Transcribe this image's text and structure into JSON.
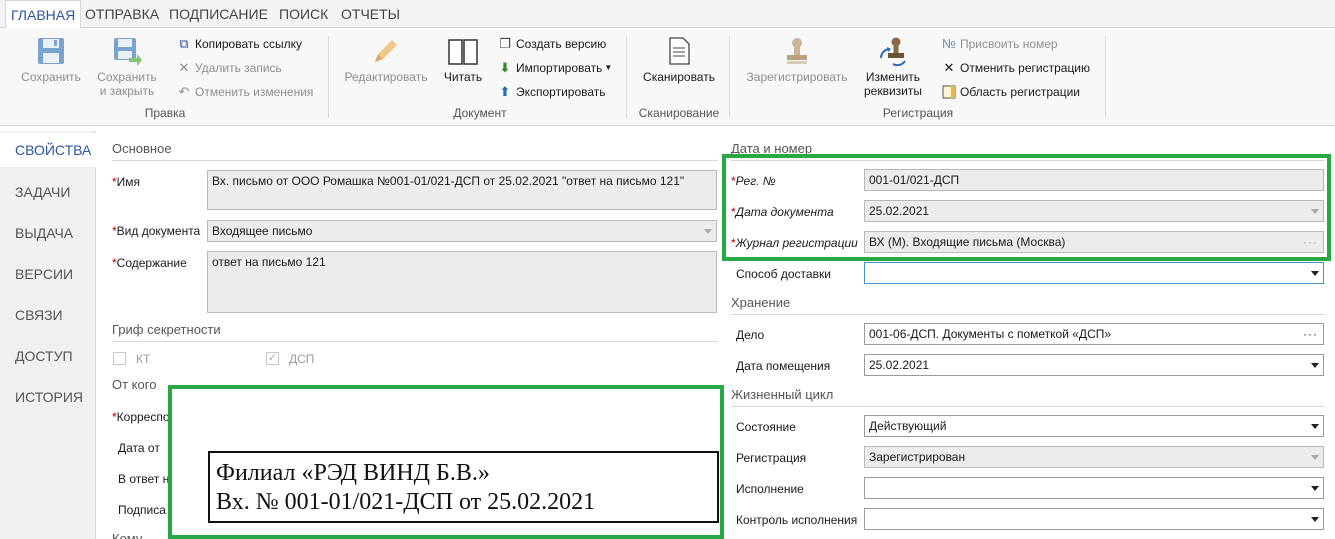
{
  "menu": {
    "tabs": [
      "ГЛАВНАЯ",
      "ОТПРАВКА",
      "ПОДПИСАНИЕ",
      "ПОИСК",
      "ОТЧЕТЫ"
    ]
  },
  "ribbon": {
    "save": "Сохранить",
    "save_close_1": "Сохранить",
    "save_close_2": "и закрыть",
    "copy_link": "Копировать ссылку",
    "delete_record": "Удалить запись",
    "undo_changes": "Отменить изменения",
    "group_edit": "Правка",
    "edit": "Редактировать",
    "read": "Читать",
    "create_version": "Создать версию",
    "import": "Импортировать",
    "export": "Экспортировать",
    "group_document": "Документ",
    "scan": "Сканировать",
    "group_scanning": "Сканирование",
    "register": "Зарегистрировать",
    "change_req_1": "Изменить",
    "change_req_2": "реквизиты",
    "assign_number": "Присвоить номер",
    "cancel_registration": "Отменить регистрацию",
    "registration_area": "Область регистрации",
    "group_registration": "Регистрация"
  },
  "nav": [
    "СВОЙСТВА",
    "ЗАДАЧИ",
    "ВЫДАЧА",
    "ВЕРСИИ",
    "СВЯЗИ",
    "ДОСТУП",
    "ИСТОРИЯ"
  ],
  "form": {
    "section_main": "Основное",
    "name_label": "Имя",
    "name_value": "Вх. письмо от ООО Ромашка №001-01/021-ДСП от 25.02.2021 \"ответ на письмо 121\"",
    "doc_type_label": "Вид документа",
    "doc_type_value": "Входящее письмо",
    "content_label": "Содержание",
    "content_value": "ответ на письмо 121",
    "section_secrecy": "Гриф секретности",
    "kt_label": "КТ",
    "dsp_label": "ДСП",
    "section_from": "От кого",
    "correspondent_label": "Корреспо",
    "date_from_label": "Дата от",
    "reply_to_label": "В ответ н",
    "signed_label": "Подписа",
    "section_to": "Кому",
    "section_date_number": "Дата и номер",
    "reg_no_label": "Рег. №",
    "reg_no_value": "001-01/021-ДСП",
    "doc_date_label": "Дата документа",
    "doc_date_value": "25.02.2021",
    "journal_label": "Журнал регистрации",
    "journal_value": "ВХ (М). Входящие письма (Москва)",
    "delivery_label": "Способ доставки",
    "delivery_value": "",
    "section_storage": "Хранение",
    "case_label": "Дело",
    "case_value": "001-06-ДСП. Документы с пометкой «ДСП»",
    "placement_date_label": "Дата помещения",
    "placement_date_value": "25.02.2021",
    "section_lifecycle": "Жизненный цикл",
    "state_label": "Состояние",
    "state_value": "Действующий",
    "registration_label": "Регистрация",
    "registration_value": "Зарегистрирован",
    "execution_label": "Исполнение",
    "execution_value": "",
    "exec_control_label": "Контроль исполнения",
    "exec_control_value": ""
  },
  "stamp": {
    "line1": "Филиал «РЭД ВИНД Б.В.»",
    "line2": "Вх. № 001-01/021-ДСП от 25.02.2021"
  },
  "colors": {
    "accent": "#2b579a",
    "highlight": "#28a745",
    "required": "#c00000"
  }
}
